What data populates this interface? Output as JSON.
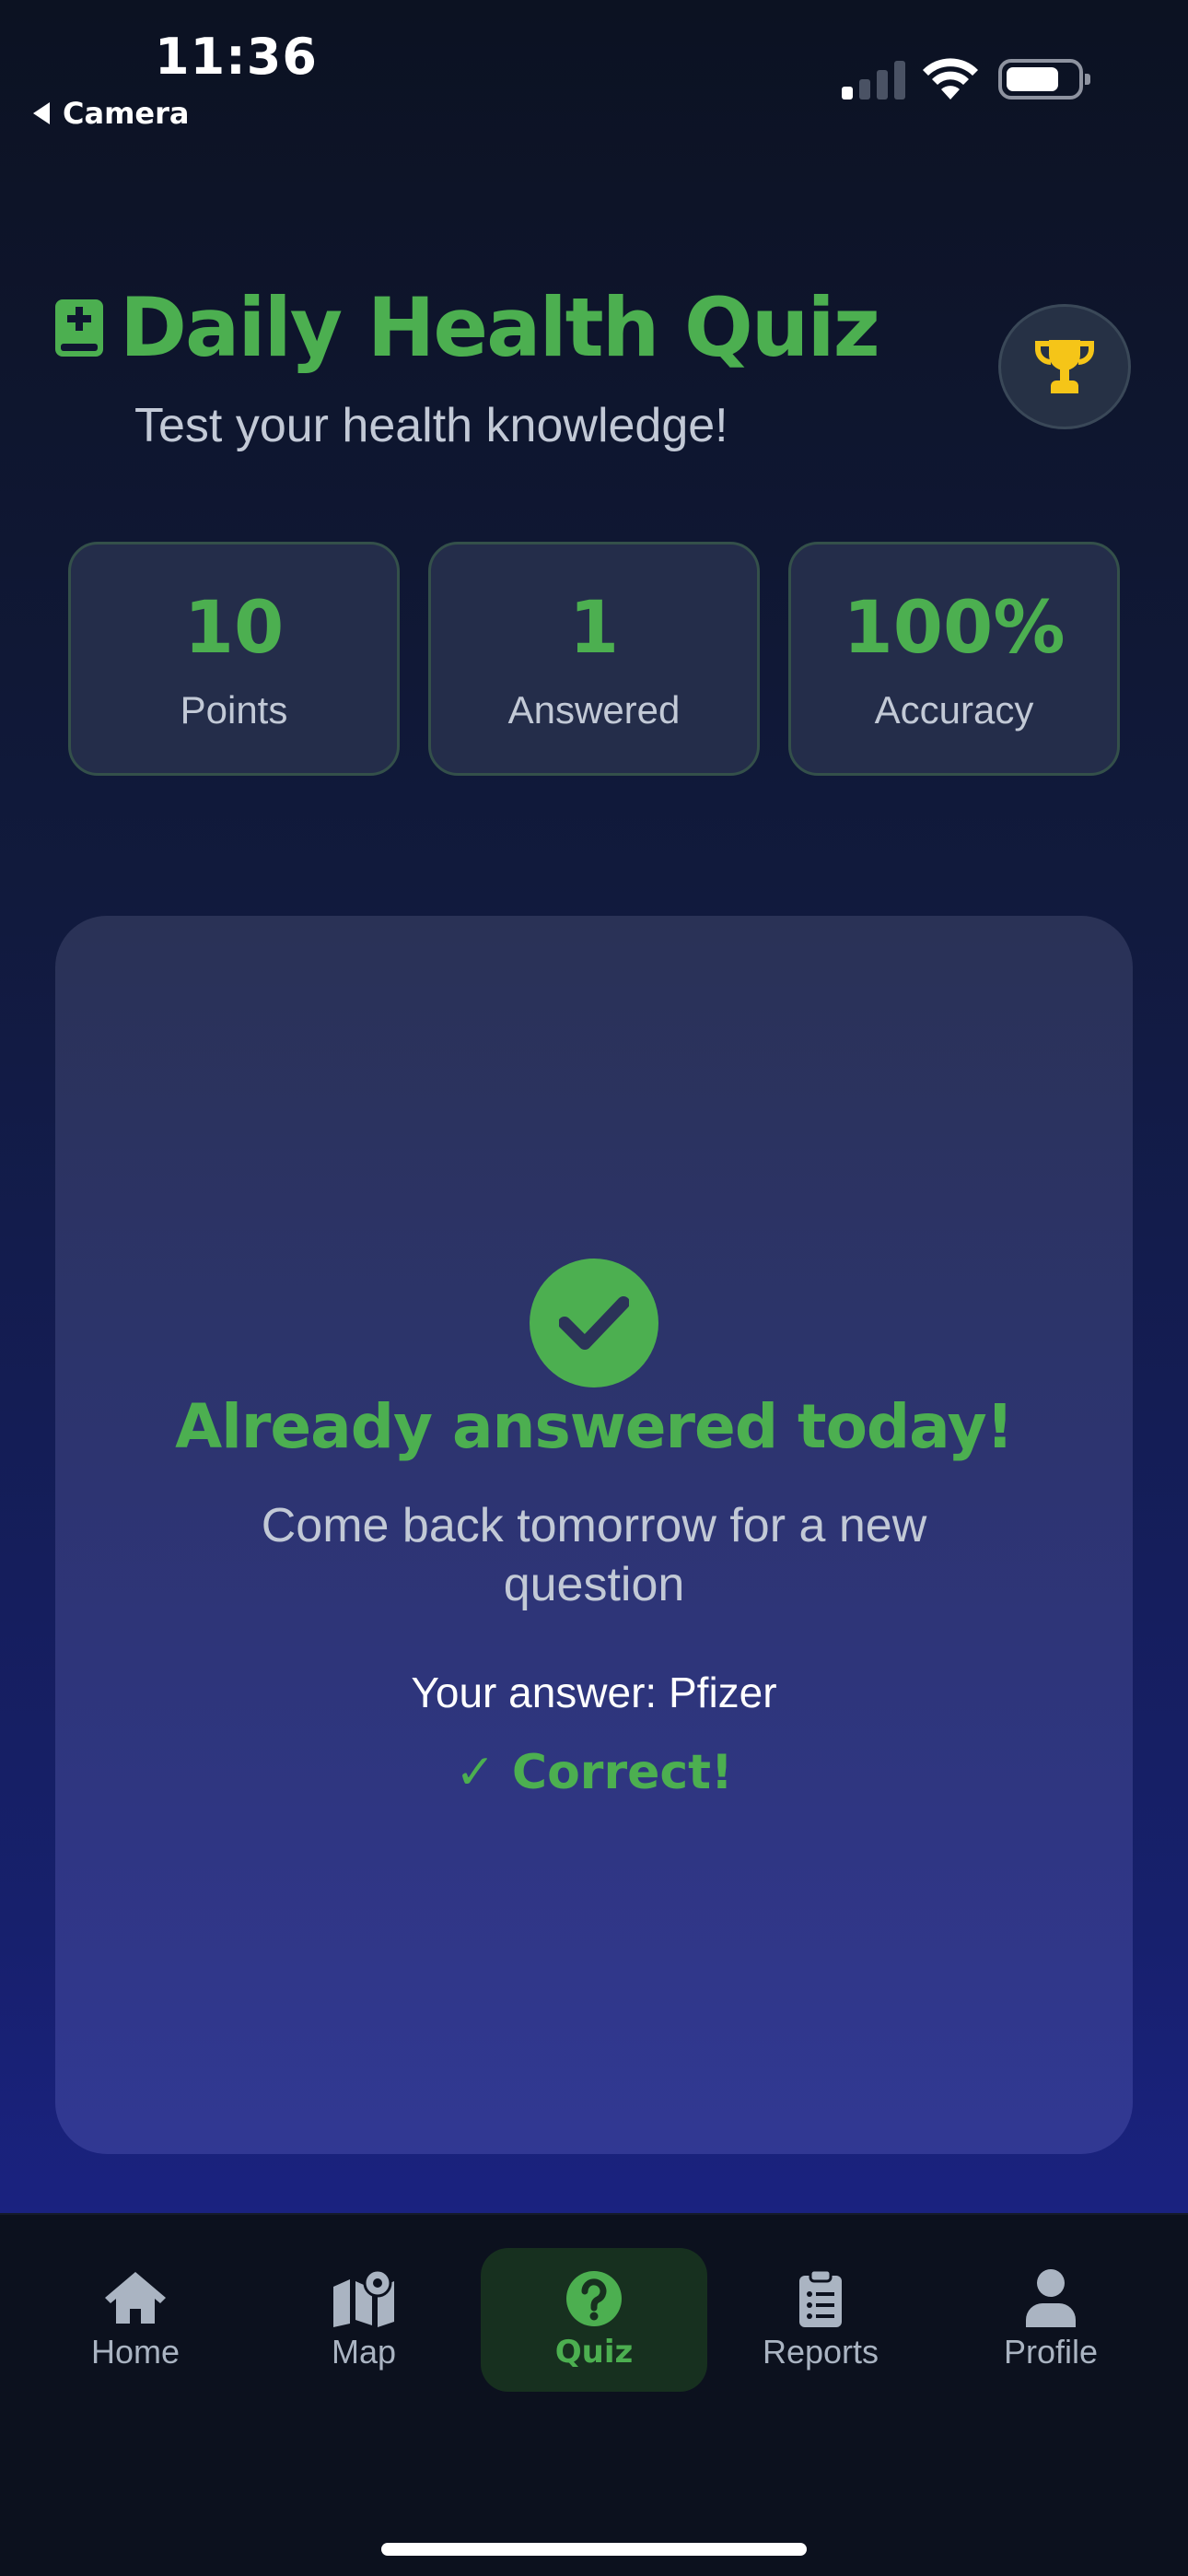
{
  "status_bar": {
    "time": "11:36",
    "back_label": "Camera",
    "icons": [
      "cellular-signal-icon",
      "wifi-icon",
      "battery-icon"
    ]
  },
  "header": {
    "title": "Daily Health Quiz",
    "subtitle": "Test your health knowledge!",
    "title_icon": "medical-book-icon",
    "trophy_icon": "trophy-icon"
  },
  "stats": [
    {
      "value": "10",
      "label": "Points"
    },
    {
      "value": "1",
      "label": "Answered"
    },
    {
      "value": "100%",
      "label": "Accuracy"
    }
  ],
  "card": {
    "icon": "check-circle-icon",
    "title": "Already answered today!",
    "subtitle": "Come back tomorrow for a new question",
    "your_answer": "Your answer: Pfizer",
    "result": "✓ Correct!"
  },
  "tabs": [
    {
      "label": "Home",
      "icon": "home-icon",
      "active": false
    },
    {
      "label": "Map",
      "icon": "map-icon",
      "active": false
    },
    {
      "label": "Quiz",
      "icon": "question-circle-icon",
      "active": true
    },
    {
      "label": "Reports",
      "icon": "clipboard-list-icon",
      "active": false
    },
    {
      "label": "Profile",
      "icon": "user-icon",
      "active": false
    }
  ],
  "colors": {
    "accent": "#4caf50",
    "text_muted": "#c2c9d6",
    "trophy": "#f5c518",
    "tab_inactive": "#aab4c2"
  }
}
